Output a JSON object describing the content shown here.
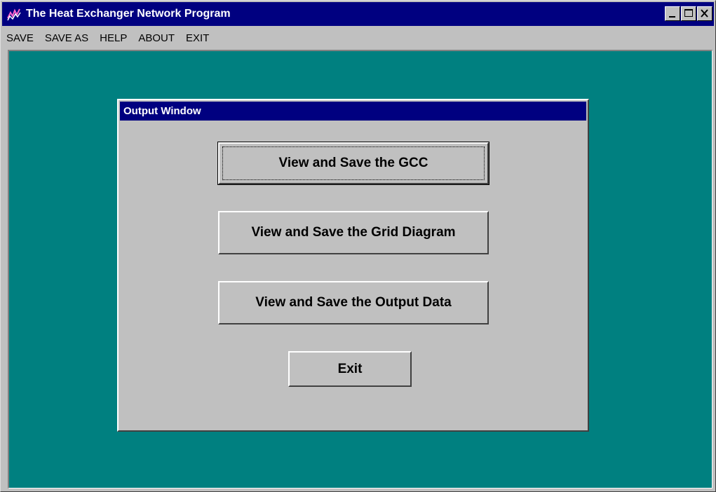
{
  "window": {
    "title": "The Heat Exchanger Network Program",
    "icon": "chart-line-icon",
    "buttons": [
      "minimize-icon",
      "maximize-icon",
      "close-icon"
    ]
  },
  "menu": {
    "items": [
      {
        "label": "SAVE"
      },
      {
        "label": "SAVE AS"
      },
      {
        "label": "HELP"
      },
      {
        "label": "ABOUT"
      },
      {
        "label": "EXIT"
      }
    ]
  },
  "output_window": {
    "title": "Output Window",
    "buttons": {
      "gcc": "View and Save the GCC",
      "grid": "View and Save the Grid Diagram",
      "output": "View and Save the Output Data",
      "exit": "Exit"
    }
  },
  "colors": {
    "desktop": "#008080",
    "title_bar": "#000080",
    "face": "#c0c0c0"
  }
}
